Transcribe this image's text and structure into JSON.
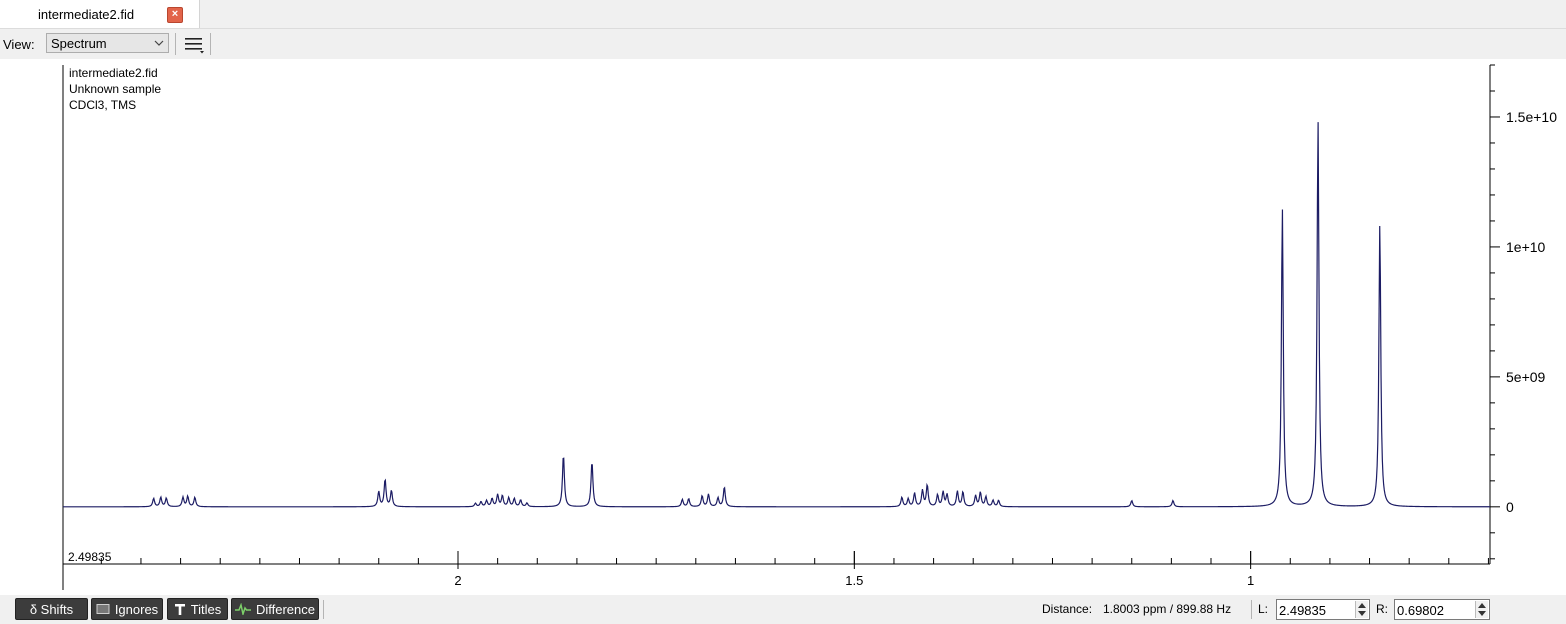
{
  "tab": {
    "title": "intermediate2.fid",
    "close_symbol": "×"
  },
  "toolbar": {
    "view_label": "View:",
    "view_value": "Spectrum"
  },
  "plot": {
    "info_lines": [
      "intermediate2.fid",
      "Unknown sample",
      "CDCl3, TMS"
    ],
    "left_label": "2.49835",
    "x_ticks": [
      "2",
      "1.5",
      "1"
    ],
    "y_ticks": [
      "1.5e+10",
      "1e+10",
      "5e+09",
      "0"
    ]
  },
  "chart_data": {
    "type": "line",
    "x_range": [
      2.49835,
      0.69802
    ],
    "y_range": [
      -2200000000.0,
      17000000000.0
    ],
    "x_tick_values": [
      2,
      1.5,
      1
    ],
    "y_tick_values": [
      15000000000,
      10000000000,
      5000000000,
      0
    ],
    "line_color": "#1c1c64",
    "peaks": [
      [
        2.384,
        320000000.0
      ],
      [
        2.375,
        360000000.0
      ],
      [
        2.368,
        330000000.0
      ],
      [
        2.347,
        360000000.0
      ],
      [
        2.341,
        400000000.0
      ],
      [
        2.332,
        360000000.0
      ],
      [
        2.1,
        580000000.0
      ],
      [
        2.092,
        1050000000.0
      ],
      [
        2.084,
        620000000.0
      ],
      [
        1.978,
        130000000.0
      ],
      [
        1.971,
        190000000.0
      ],
      [
        1.964,
        230000000.0
      ],
      [
        1.957,
        310000000.0
      ],
      [
        1.95,
        460000000.0
      ],
      [
        1.944,
        420000000.0
      ],
      [
        1.936,
        340000000.0
      ],
      [
        1.929,
        310000000.0
      ],
      [
        1.921,
        260000000.0
      ],
      [
        1.913,
        140000000.0
      ],
      [
        1.867,
        2020000000.0
      ],
      [
        1.831,
        1750000000.0
      ],
      [
        1.717,
        280000000.0
      ],
      [
        1.709,
        310000000.0
      ],
      [
        1.692,
        420000000.0
      ],
      [
        1.684,
        480000000.0
      ],
      [
        1.672,
        340000000.0
      ],
      [
        1.664,
        760000000.0
      ],
      [
        1.44,
        360000000.0
      ],
      [
        1.432,
        300000000.0
      ],
      [
        1.424,
        520000000.0
      ],
      [
        1.414,
        620000000.0
      ],
      [
        1.408,
        830000000.0
      ],
      [
        1.395,
        450000000.0
      ],
      [
        1.388,
        560000000.0
      ],
      [
        1.383,
        460000000.0
      ],
      [
        1.37,
        590000000.0
      ],
      [
        1.363,
        560000000.0
      ],
      [
        1.347,
        420000000.0
      ],
      [
        1.341,
        550000000.0
      ],
      [
        1.334,
        380000000.0
      ],
      [
        1.325,
        240000000.0
      ],
      [
        1.318,
        240000000.0
      ],
      [
        1.15,
        240000000.0
      ],
      [
        1.098,
        240000000.0
      ],
      [
        0.96,
        11500000000.0
      ],
      [
        0.915,
        14900000000.0
      ],
      [
        0.837,
        10900000000.0
      ]
    ]
  },
  "bottom": {
    "buttons": [
      "δ Shifts",
      "Ignores",
      "Titles",
      "Difference"
    ],
    "distance_label": "Distance:",
    "distance_value": "1.8003 ppm / 899.88 Hz",
    "l_label": "L:",
    "l_value": "2.49835",
    "r_label": "R:",
    "r_value": "0.69802"
  }
}
